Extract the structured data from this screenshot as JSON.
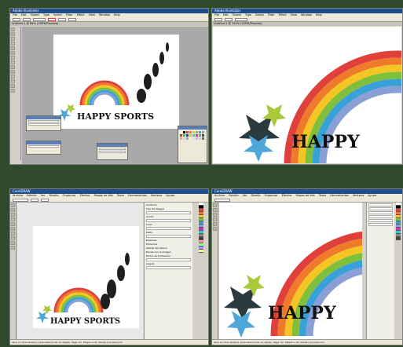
{
  "q1": {
    "title": "Adobe Illustrator",
    "doc_tab": "Untitled-1 @ 66% (CMYK/Preview)",
    "menu": [
      "File",
      "Edit",
      "Object",
      "Type",
      "Select",
      "Filter",
      "Effect",
      "View",
      "Window",
      "Help"
    ],
    "artwork_text": "HAPPY SPORTS"
  },
  "q2": {
    "title": "Adobe Illustrator",
    "doc_tab": "Untitled-1 @ 193% (CMYK/Preview)",
    "menu": [
      "File",
      "Edit",
      "Object",
      "Type",
      "Select",
      "Filter",
      "Effect",
      "View",
      "Window",
      "Help"
    ],
    "artwork_text": "HAPPY"
  },
  "q3": {
    "title": "CorelDRAW",
    "menu": [
      "Archivo",
      "Edición",
      "Ver",
      "Diseño",
      "Organizar",
      "Efectos",
      "Mapas de bits",
      "Texto",
      "Herramientas",
      "Ventana",
      "Ayuda"
    ],
    "artwork_text": "HAPPY SPORTS",
    "docker": {
      "tab": "Contorno",
      "labels": [
        "Tipo de bisagra",
        "Ancho",
        "Color",
        "Estilo",
        "Esquinas",
        "Extremos",
        "Factor de inclinación",
        "Ángulo"
      ],
      "checkbox_1": "Detrás del relleno",
      "checkbox_2": "Escala con la imagen"
    },
    "status": "Abre en otra ventana; para seleccionar un objeto, haga clic. Mayús.+clic añade a la selección."
  },
  "q4": {
    "title": "CorelDRAW",
    "menu": [
      "Archivo",
      "Edición",
      "Ver",
      "Diseño",
      "Organizar",
      "Efectos",
      "Mapas de bits",
      "Texto",
      "Herramientas",
      "Ventana",
      "Ayuda"
    ],
    "artwork_text": "HAPPY",
    "status": "Abre en otra ventana; para seleccionar un objeto, haga clic. Mayús.+clic añade a la selección."
  },
  "colors": {
    "rainbow": [
      "#e0403a",
      "#ee7a2a",
      "#f3c623",
      "#7fbf3a",
      "#3aa0d8",
      "#8a9fd6"
    ],
    "star_green": "#a9c93a",
    "star_blue": "#4fa6d8",
    "star_dark": "#2b3a3f"
  }
}
